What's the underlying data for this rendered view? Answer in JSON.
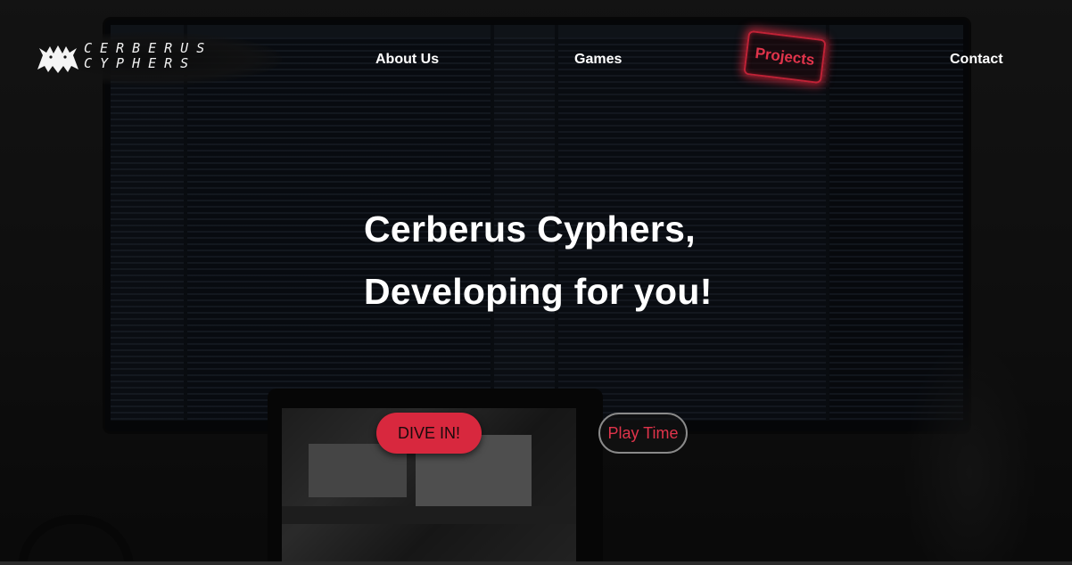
{
  "brand": {
    "logo_line1": "Cerberus",
    "logo_line2": "Cyphers",
    "logo_icon": "cerberus-dog-icon"
  },
  "nav": {
    "about": "About Us",
    "games": "Games",
    "projects": "Projects",
    "contact": "Contact",
    "active_color": "#e0344b"
  },
  "hero": {
    "headline_line1": "Cerberus Cyphers,",
    "headline_line2": "Developing for you!",
    "background_description_icon": "monitor-code-background"
  },
  "cta": {
    "primary_label": "DIVE IN!",
    "secondary_label": "Play Time",
    "primary_color": "#d8283e",
    "secondary_text_color": "#e0344b"
  }
}
